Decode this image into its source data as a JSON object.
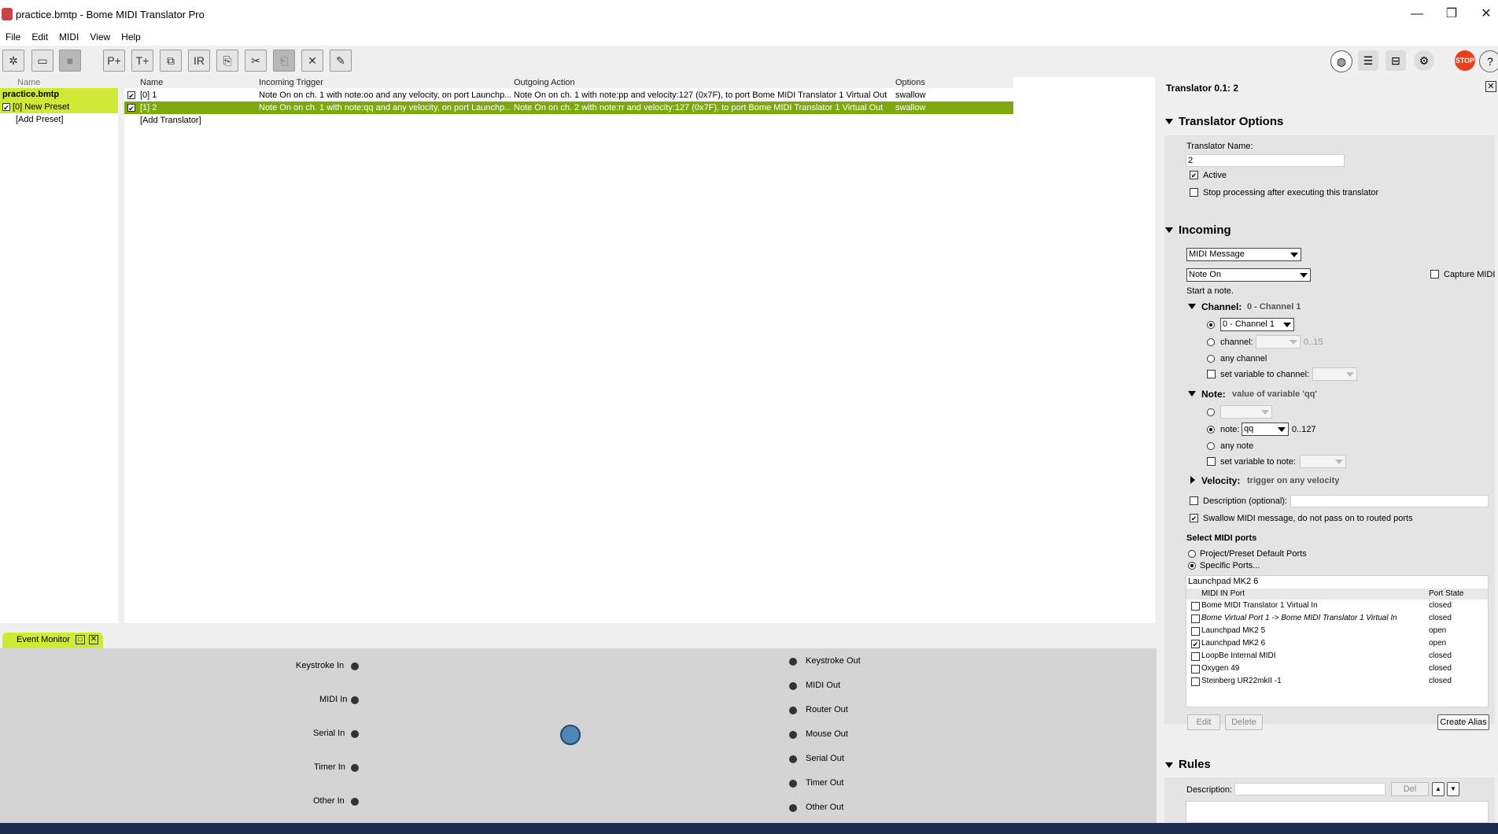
{
  "window": {
    "title": "practice.bmtp - Bome MIDI Translator Pro",
    "minimize": "—",
    "restore": "❐",
    "close": "✕"
  },
  "menu": [
    "File",
    "Edit",
    "MIDI",
    "View",
    "Help"
  ],
  "presets": {
    "header": "Name",
    "project": "practice.bmtp",
    "items": [
      {
        "label": "[0] New Preset",
        "checked": "✔"
      }
    ],
    "add": "[Add Preset]"
  },
  "translators": {
    "headers": {
      "name": "Name",
      "incoming": "Incoming Trigger",
      "outgoing": "Outgoing Action",
      "options": "Options"
    },
    "rows": [
      {
        "check": "✔",
        "name": "[0] 1",
        "incoming": "Note On on ch. 1 with note:oo and any velocity, on port Launchp...",
        "outgoing": "Note On on ch. 1 with note:pp and velocity:127 (0x7F), to port Bome MIDI Translator 1 Virtual Out",
        "options": "swallow"
      },
      {
        "check": "✔",
        "name": "[1] 2",
        "incoming": "Note On on ch. 1 with note:qq and any velocity, on port Launchp...",
        "outgoing": "Note On on ch. 2 with note:rr and velocity:127 (0x7F), to port Bome MIDI Translator 1 Virtual Out",
        "options": "swallow"
      }
    ],
    "add": "[Add Translator]"
  },
  "event_monitor": {
    "tab": "Event Monitor",
    "inputs": [
      "Keystroke In",
      "MIDI In",
      "Serial In",
      "Timer In",
      "Other In"
    ],
    "outputs": [
      "Keystroke Out",
      "MIDI Out",
      "Router Out",
      "Mouse Out",
      "Serial Out",
      "Timer Out",
      "Other Out"
    ]
  },
  "inspector": {
    "title": "Translator 0.1: 2",
    "options": {
      "heading": "Translator Options",
      "name_label": "Translator Name:",
      "name_value": "2",
      "active_label": "Active",
      "stop_label": "Stop processing after executing this translator"
    },
    "incoming": {
      "heading": "Incoming",
      "type": "MIDI Message",
      "message": "Note On",
      "capture": "Capture MIDI",
      "description": "Start a note.",
      "channel": {
        "label": "Channel:",
        "summary": "0 - Channel 1",
        "select_value": "0 - Channel 1",
        "channel_label": "channel:",
        "range": "0..15",
        "any": "any channel",
        "set_var": "set variable to channel:"
      },
      "note": {
        "label": "Note:",
        "summary": "value of variable 'qq'",
        "note_label": "note:",
        "note_value": "qq",
        "range": "0..127",
        "any": "any note",
        "set_var": "set variable to note:"
      },
      "velocity": {
        "label": "Velocity:",
        "summary": "trigger on any velocity"
      },
      "desc_label": "Description (optional):",
      "swallow_label": "Swallow MIDI message, do not pass on to routed ports",
      "ports": {
        "heading": "Select MIDI ports",
        "default": "Project/Preset Default Ports",
        "specific": "Specific Ports...",
        "summary": "Launchpad MK2 6",
        "col_port": "MIDI IN Port",
        "col_state": "Port State",
        "list": [
          {
            "name": "Bome MIDI Translator 1 Virtual In",
            "state": "closed",
            "check": ""
          },
          {
            "name": "Bome Virtual Port 1 -> Bome MIDI Translator 1 Virtual In",
            "state": "closed",
            "check": ""
          },
          {
            "name": "Launchpad MK2 5",
            "state": "open",
            "check": ""
          },
          {
            "name": "Launchpad MK2 6",
            "state": "open",
            "check": "✔"
          },
          {
            "name": "LoopBe Internal MIDI",
            "state": "closed",
            "check": ""
          },
          {
            "name": "Oxygen 49",
            "state": "closed",
            "check": ""
          },
          {
            "name": "Steinberg UR22mkII -1",
            "state": "closed",
            "check": ""
          }
        ],
        "edit": "Edit",
        "delete": "Delete",
        "create_alias": "Create Alias"
      }
    },
    "rules": {
      "heading": "Rules",
      "desc_label": "Description:",
      "del": "Del",
      "up": "▲",
      "down": "▼"
    }
  },
  "toolbar_icons": [
    "project-icon",
    "open-icon",
    "save-icon",
    "add-preset-icon",
    "add-translator-icon",
    "duplicate-icon",
    "rename-icon",
    "copy-icon",
    "cut-icon",
    "paste-icon",
    "delete-icon",
    "edit-icon"
  ],
  "right_icons": [
    "midi-icon",
    "settings-list-icon",
    "mapping-icon",
    "gear-icon",
    "stop-icon",
    "help-icon"
  ],
  "stop_label": "STOP",
  "colors": {
    "selected_preset": "#cfea35",
    "selected_row": "#7ea80f",
    "stop": "#e8401c"
  }
}
